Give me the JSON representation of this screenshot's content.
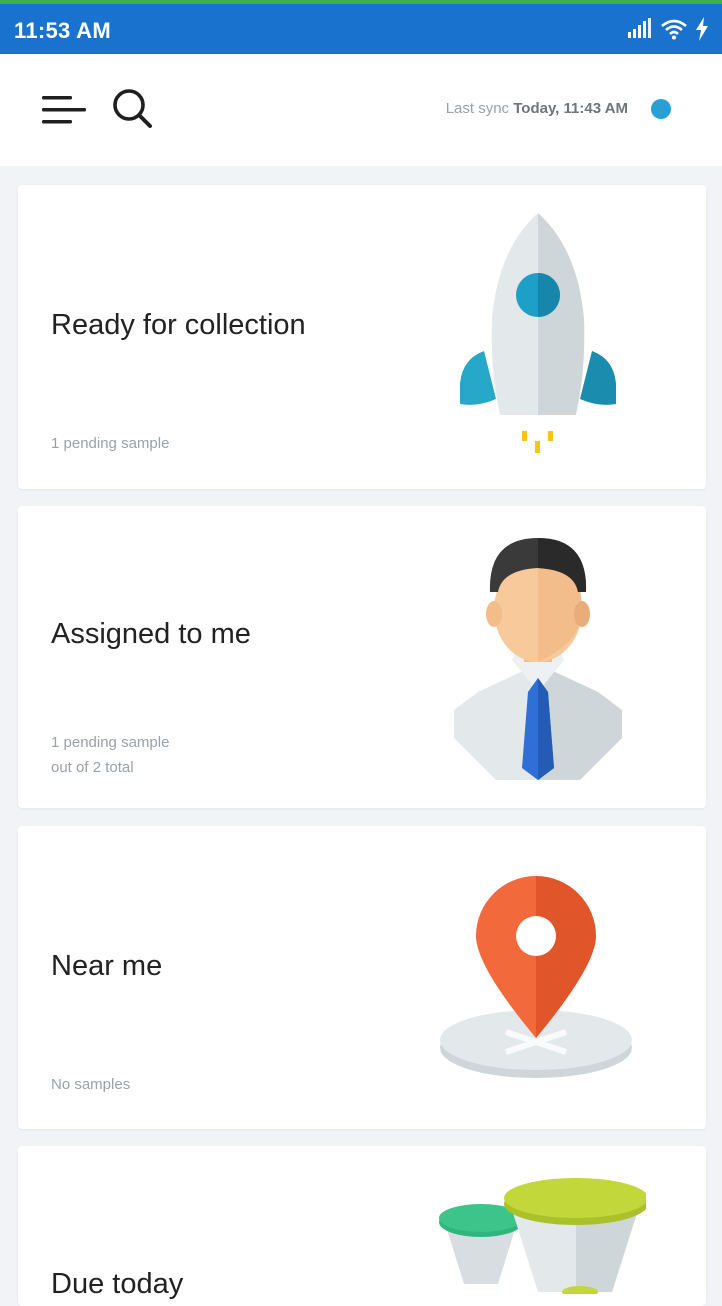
{
  "status_bar": {
    "time": "11:53 AM",
    "icons": [
      "signal-icon",
      "wifi-icon",
      "charging-icon"
    ],
    "color": "#1a72cf"
  },
  "header": {
    "menu_icon": "menu-icon",
    "search_icon": "search-icon",
    "sync_label": "Last sync",
    "sync_time": "Today, 11:43 AM",
    "sync_status_color": "#2a9fd6"
  },
  "cards": [
    {
      "title": "Ready for collection",
      "subtitle_line1": "1 pending sample",
      "subtitle_line2": "",
      "illustration": "rocket-icon"
    },
    {
      "title": "Assigned to me",
      "subtitle_line1": "1 pending sample",
      "subtitle_line2": "out of 2 total",
      "illustration": "person-icon"
    },
    {
      "title": "Near me",
      "subtitle_line1": "No samples",
      "subtitle_line2": "",
      "illustration": "map-pin-icon"
    },
    {
      "title": "Due today",
      "subtitle_line1": "",
      "subtitle_line2": "",
      "illustration": "hourglass-icon"
    }
  ]
}
